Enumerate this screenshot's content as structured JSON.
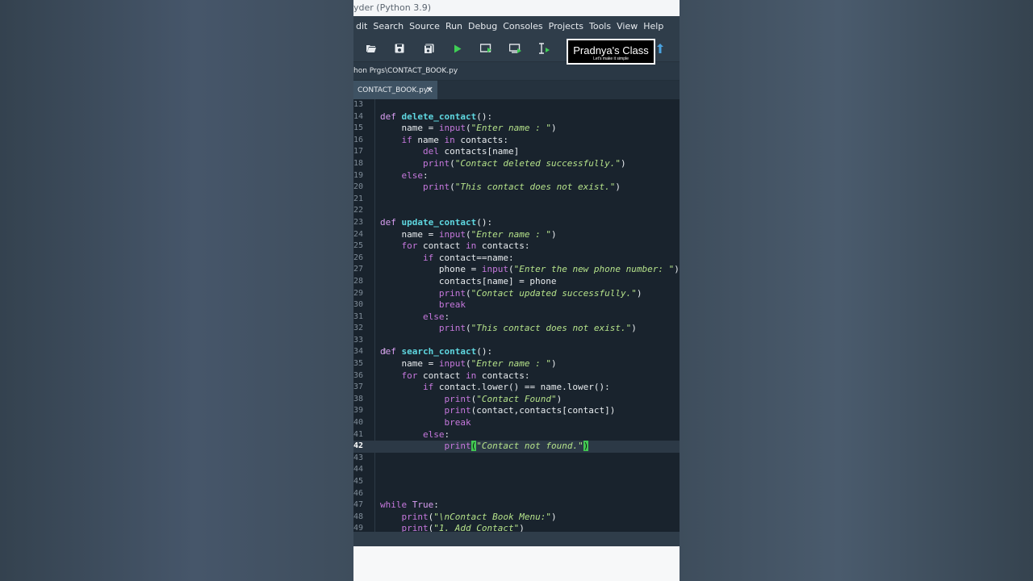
{
  "window": {
    "title": "yder (Python 3.9)"
  },
  "menu": [
    "dit",
    "Search",
    "Source",
    "Run",
    "Debug",
    "Consoles",
    "Projects",
    "Tools",
    "View",
    "Help"
  ],
  "toolbar": {
    "icons": [
      "open-folder-icon",
      "save-icon",
      "save-all-icon",
      "run-icon",
      "run-cell-icon",
      "run-cell-advance-icon",
      "run-selection-icon",
      "upload-icon"
    ],
    "brand_name": "Pradnya's Class",
    "brand_tagline": "Let's make it simple"
  },
  "path": "hon Prgs\\CONTACT_BOOK.py",
  "tab": {
    "label": "CONTACT_BOOK.py*",
    "close": "✕"
  },
  "editor": {
    "current_line": "42",
    "lines": [
      {
        "n": "13",
        "t": [
          [
            "",
            ""
          ]
        ]
      },
      {
        "n": "14",
        "t": [
          [
            "kw",
            "def "
          ],
          [
            "fn",
            "delete_contact"
          ],
          [
            "",
            "():"
          ]
        ]
      },
      {
        "n": "15",
        "t": [
          [
            "",
            "    name = "
          ],
          [
            "bi",
            "input"
          ],
          [
            "",
            "("
          ],
          [
            "str",
            "\"Enter name : \""
          ],
          [
            "",
            ")"
          ]
        ]
      },
      {
        "n": "16",
        "t": [
          [
            "",
            "    "
          ],
          [
            "ctl",
            "if"
          ],
          [
            "",
            " name "
          ],
          [
            "ctl",
            "in"
          ],
          [
            "",
            " contacts:"
          ]
        ]
      },
      {
        "n": "17",
        "t": [
          [
            "",
            "        "
          ],
          [
            "ctl",
            "del"
          ],
          [
            "",
            " contacts[name]"
          ]
        ]
      },
      {
        "n": "18",
        "t": [
          [
            "",
            "        "
          ],
          [
            "bi",
            "print"
          ],
          [
            "",
            "("
          ],
          [
            "str",
            "\"Contact deleted successfully.\""
          ],
          [
            "",
            ")"
          ]
        ]
      },
      {
        "n": "19",
        "t": [
          [
            "",
            "    "
          ],
          [
            "ctl",
            "else"
          ],
          [
            "",
            ":"
          ]
        ]
      },
      {
        "n": "20",
        "t": [
          [
            "",
            "        "
          ],
          [
            "bi",
            "print"
          ],
          [
            "",
            "("
          ],
          [
            "str",
            "\"This contact does not exist.\""
          ],
          [
            "",
            ")"
          ]
        ]
      },
      {
        "n": "21",
        "t": [
          [
            "",
            ""
          ]
        ]
      },
      {
        "n": "22",
        "t": [
          [
            "",
            ""
          ]
        ]
      },
      {
        "n": "23",
        "t": [
          [
            "kw",
            "def "
          ],
          [
            "fn",
            "update_contact"
          ],
          [
            "",
            "():"
          ]
        ]
      },
      {
        "n": "24",
        "t": [
          [
            "",
            "    name = "
          ],
          [
            "bi",
            "input"
          ],
          [
            "",
            "("
          ],
          [
            "str",
            "\"Enter name : \""
          ],
          [
            "",
            ")"
          ]
        ]
      },
      {
        "n": "25",
        "t": [
          [
            "",
            "    "
          ],
          [
            "ctl",
            "for"
          ],
          [
            "",
            " contact "
          ],
          [
            "ctl",
            "in"
          ],
          [
            "",
            " contacts:"
          ]
        ]
      },
      {
        "n": "26",
        "t": [
          [
            "",
            "        "
          ],
          [
            "ctl",
            "if"
          ],
          [
            "",
            " contact==name:"
          ]
        ]
      },
      {
        "n": "27",
        "t": [
          [
            "",
            "           phone = "
          ],
          [
            "bi",
            "input"
          ],
          [
            "",
            "("
          ],
          [
            "str",
            "\"Enter the new phone number: \""
          ],
          [
            "",
            ")"
          ]
        ]
      },
      {
        "n": "28",
        "t": [
          [
            "",
            "           contacts[name] = phone"
          ]
        ]
      },
      {
        "n": "29",
        "t": [
          [
            "",
            "           "
          ],
          [
            "bi",
            "print"
          ],
          [
            "",
            "("
          ],
          [
            "str",
            "\"Contact updated successfully.\""
          ],
          [
            "",
            ")"
          ]
        ]
      },
      {
        "n": "30",
        "t": [
          [
            "",
            "           "
          ],
          [
            "ctl",
            "break"
          ]
        ]
      },
      {
        "n": "31",
        "t": [
          [
            "",
            "        "
          ],
          [
            "ctl",
            "else"
          ],
          [
            "",
            ":"
          ]
        ]
      },
      {
        "n": "32",
        "t": [
          [
            "",
            "           "
          ],
          [
            "bi",
            "print"
          ],
          [
            "",
            "("
          ],
          [
            "str",
            "\"This contact does not exist.\""
          ],
          [
            "",
            ")"
          ]
        ]
      },
      {
        "n": "33",
        "t": [
          [
            "",
            ""
          ]
        ]
      },
      {
        "n": "34",
        "t": [
          [
            "kw",
            "def "
          ],
          [
            "fn",
            "search_contact"
          ],
          [
            "",
            "():"
          ]
        ]
      },
      {
        "n": "35",
        "t": [
          [
            "",
            "    name = "
          ],
          [
            "bi",
            "input"
          ],
          [
            "",
            "("
          ],
          [
            "str",
            "\"Enter name : \""
          ],
          [
            "",
            ")"
          ]
        ]
      },
      {
        "n": "36",
        "t": [
          [
            "",
            "    "
          ],
          [
            "ctl",
            "for"
          ],
          [
            "",
            " contact "
          ],
          [
            "ctl",
            "in"
          ],
          [
            "",
            " contacts:"
          ]
        ]
      },
      {
        "n": "37",
        "t": [
          [
            "",
            "        "
          ],
          [
            "ctl",
            "if"
          ],
          [
            "",
            " contact.lower() == name.lower():"
          ]
        ]
      },
      {
        "n": "38",
        "t": [
          [
            "",
            "            "
          ],
          [
            "bi",
            "print"
          ],
          [
            "",
            "("
          ],
          [
            "str",
            "\"Contact Found\""
          ],
          [
            "",
            ")"
          ]
        ]
      },
      {
        "n": "39",
        "t": [
          [
            "",
            "            "
          ],
          [
            "bi",
            "print"
          ],
          [
            "",
            "(contact,contacts[contact])"
          ]
        ]
      },
      {
        "n": "40",
        "t": [
          [
            "",
            "            "
          ],
          [
            "ctl",
            "break"
          ]
        ]
      },
      {
        "n": "41",
        "t": [
          [
            "",
            "        "
          ],
          [
            "ctl",
            "else"
          ],
          [
            "",
            ":"
          ]
        ]
      },
      {
        "n": "42",
        "t": [
          [
            "",
            "            "
          ],
          [
            "bi",
            "print"
          ],
          [
            "br-hl",
            "("
          ],
          [
            "str",
            "\"Contact not found.\""
          ],
          [
            "br-hl",
            ")"
          ]
        ]
      },
      {
        "n": "43",
        "t": [
          [
            "",
            ""
          ]
        ]
      },
      {
        "n": "44",
        "t": [
          [
            "",
            ""
          ]
        ]
      },
      {
        "n": "45",
        "t": [
          [
            "",
            ""
          ]
        ]
      },
      {
        "n": "46",
        "t": [
          [
            "",
            ""
          ]
        ]
      },
      {
        "n": "47",
        "t": [
          [
            "ctl",
            "while"
          ],
          [
            "",
            " "
          ],
          [
            "kw",
            "True"
          ],
          [
            "",
            ":"
          ]
        ]
      },
      {
        "n": "48",
        "t": [
          [
            "",
            "    "
          ],
          [
            "bi",
            "print"
          ],
          [
            "",
            "("
          ],
          [
            "str",
            "\"\\nContact Book Menu:\""
          ],
          [
            "",
            ")"
          ]
        ]
      },
      {
        "n": "49",
        "t": [
          [
            "",
            "    "
          ],
          [
            "bi",
            "print"
          ],
          [
            "",
            "("
          ],
          [
            "str",
            "\"1. Add Contact\""
          ],
          [
            "",
            ")"
          ]
        ]
      }
    ]
  },
  "colors": {
    "keyword": "#c678dd",
    "function_name": "#5fd7e0",
    "string": "#b5e28a",
    "bracket_match": "#42c853",
    "editor_bg": "#19232d",
    "toolbar_bg": "#2f3d4a"
  }
}
